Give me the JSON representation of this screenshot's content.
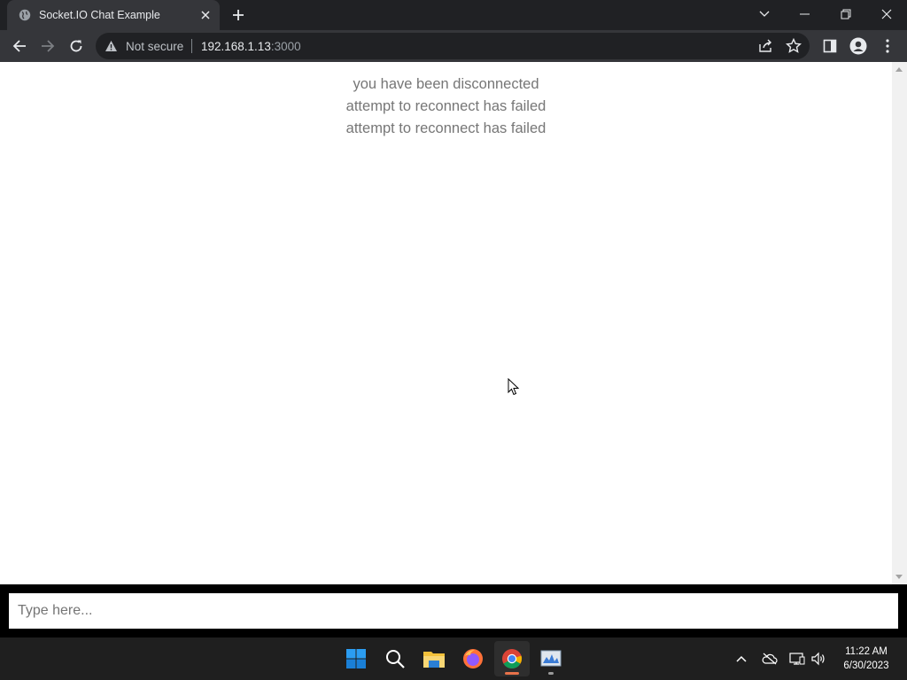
{
  "browser": {
    "tab_title": "Socket.IO Chat Example",
    "security_label": "Not secure",
    "url_host": "192.168.1.13",
    "url_port": ":3000"
  },
  "page": {
    "messages": [
      "you have been disconnected",
      "attempt to reconnect has failed",
      "attempt to reconnect has failed"
    ],
    "input_placeholder": "Type here...",
    "input_value": ""
  },
  "taskbar": {
    "apps": [
      "start-icon",
      "search-icon",
      "file-explorer-icon",
      "firefox-icon",
      "chrome-icon",
      "monitor-app-icon"
    ],
    "time": "11:22 AM",
    "date": "6/30/2023"
  },
  "colors": {
    "chrome_dark": "#202124",
    "chrome_toolbar": "#35363a",
    "message_text": "#767676",
    "form_bg": "#000000",
    "active_indicator": "#e8724a"
  }
}
